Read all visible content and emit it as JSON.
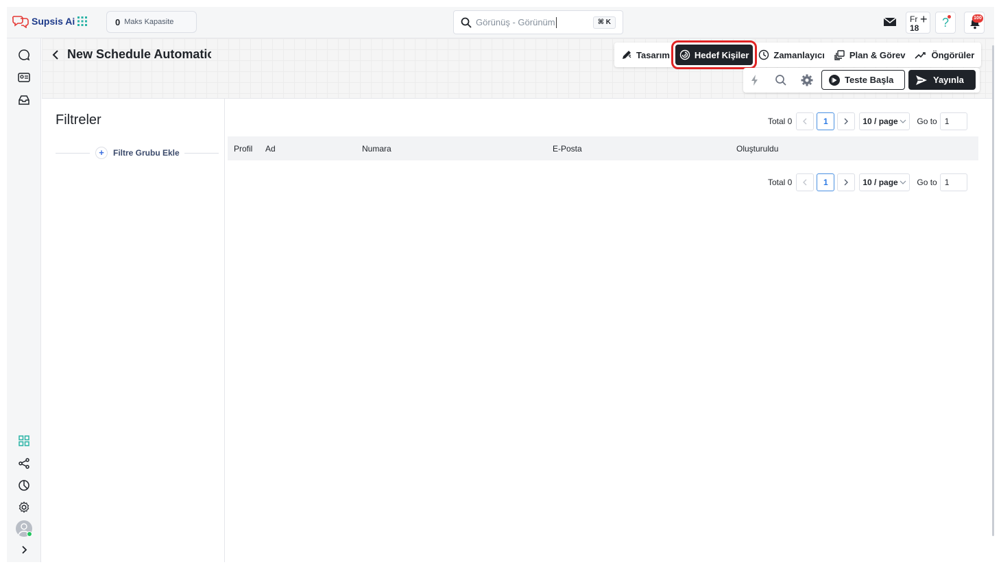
{
  "brand": {
    "name": "Supsis Ai"
  },
  "capacity": {
    "value": "0",
    "label": "Maks Kapasite"
  },
  "search": {
    "placeholder": "Görünüş - Görünüm",
    "shortcut": "⌘ K"
  },
  "lang": {
    "code": "Fr",
    "day": "18"
  },
  "help": {
    "glyph": "?"
  },
  "notifications": {
    "count": "100"
  },
  "page": {
    "title": "New Schedule Automation"
  },
  "tabs": [
    {
      "label": "Tasarım",
      "icon": "design-pen-icon",
      "active": false
    },
    {
      "label": "Hedef Kişiler",
      "icon": "target-people-icon",
      "active": true
    },
    {
      "label": "Zamanlayıcı",
      "icon": "clock-icon",
      "active": false
    },
    {
      "label": "Plan & Görev",
      "icon": "plan-task-icon",
      "active": false
    },
    {
      "label": "Öngörüler",
      "icon": "insights-trend-icon",
      "active": false
    }
  ],
  "actions": {
    "test_label": "Teste Başla",
    "publish_label": "Yayınla"
  },
  "filters": {
    "title": "Filtreler",
    "add_group_label": "Filtre Grubu Ekle"
  },
  "table": {
    "columns": [
      "Profil",
      "Ad",
      "Numara",
      "E-Posta",
      "Oluşturuldu"
    ],
    "rows": []
  },
  "pagination": {
    "total_label": "Total 0",
    "current_page": "1",
    "page_size_label": "10 / page",
    "goto_label": "Go to",
    "goto_value": "1"
  },
  "colors": {
    "accent": "#1f2329",
    "highlight": "#e02424",
    "brand": "#1d3a8a",
    "link": "#2d7be5"
  }
}
